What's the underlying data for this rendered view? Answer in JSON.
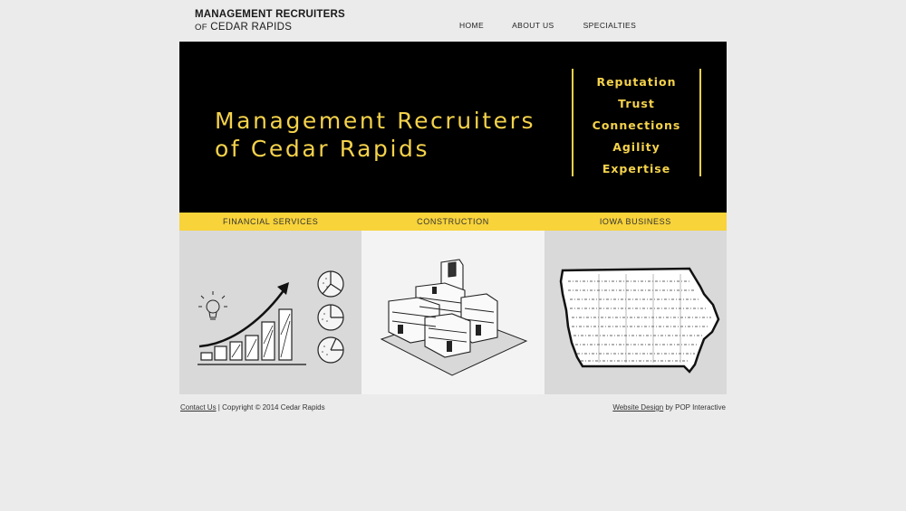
{
  "header": {
    "logo_line1": "MANAGEMENT RECRUITERS",
    "logo_line2_of": "OF",
    "logo_line2_rest": "CEDAR RAPIDS"
  },
  "nav": [
    {
      "label": "HOME"
    },
    {
      "label": "ABOUT US"
    },
    {
      "label": "SPECIALTIES"
    }
  ],
  "banner": {
    "title_line1": "Management Recruiters",
    "title_line2": "of Cedar Rapids",
    "values": [
      "Reputation",
      "Trust",
      "Connections",
      "Agility",
      "Expertise"
    ]
  },
  "specialties": [
    {
      "label": "FINANCIAL SERVICES",
      "image": "finance-growth-sketch"
    },
    {
      "label": "CONSTRUCTION",
      "image": "building-sketch"
    },
    {
      "label": "IOWA BUSINESS",
      "image": "iowa-map-sketch"
    }
  ],
  "footer": {
    "contact_label": "Contact Us",
    "copyright": " | Copyright © 2014 Cedar Rapids",
    "design_link": "Website Design",
    "design_credit": " by POP Interactive"
  },
  "colors": {
    "accent_yellow": "#f4d24b",
    "strip_yellow": "#f8d33a",
    "banner_bg": "#000000",
    "page_bg": "#ebebeb"
  }
}
